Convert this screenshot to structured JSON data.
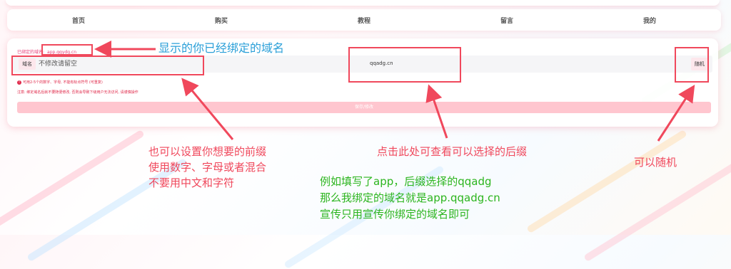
{
  "nav": {
    "items": [
      "首页",
      "购买",
      "教程",
      "留言",
      "我的"
    ]
  },
  "form": {
    "bound_label": "已绑定的域名:",
    "bound_domain": "app.qqydg.cn",
    "prefix_label": "域名",
    "prefix_placeholder": "不修改请留空",
    "suffix_value": "qqadg.cn",
    "random_label": "随机",
    "rule_hint": "可用2-5个的数字、字母, 不能有标点符号 (可重复)",
    "note_hint": "注意: 绑定域名后就不要随便修改, 否则会导致下级用户无法访问, 请谨慎操作",
    "save_label": "保存/修改"
  },
  "annotations": {
    "bound_domain_text": "显示的你已经绑定的域名",
    "prefix_lines": [
      "也可以设置你想要的前缀",
      "使用数字、字母或者混合",
      "不要用中文和字符"
    ],
    "suffix_text": "点击此处可查看可以选择的后缀",
    "example_lines": [
      "例如填写了app，后缀选择的qqadg",
      "那么我绑定的域名就是app.qqadg.cn",
      "宣传只用宣传你绑定的域名即可"
    ],
    "random_text": "可以随机"
  },
  "colors": {
    "accent": "#e8417a",
    "annotation_red": "#f0485c",
    "annotation_blue": "#2a9fd8",
    "annotation_green": "#2cb51e",
    "save_button": "#ffc6cf"
  }
}
